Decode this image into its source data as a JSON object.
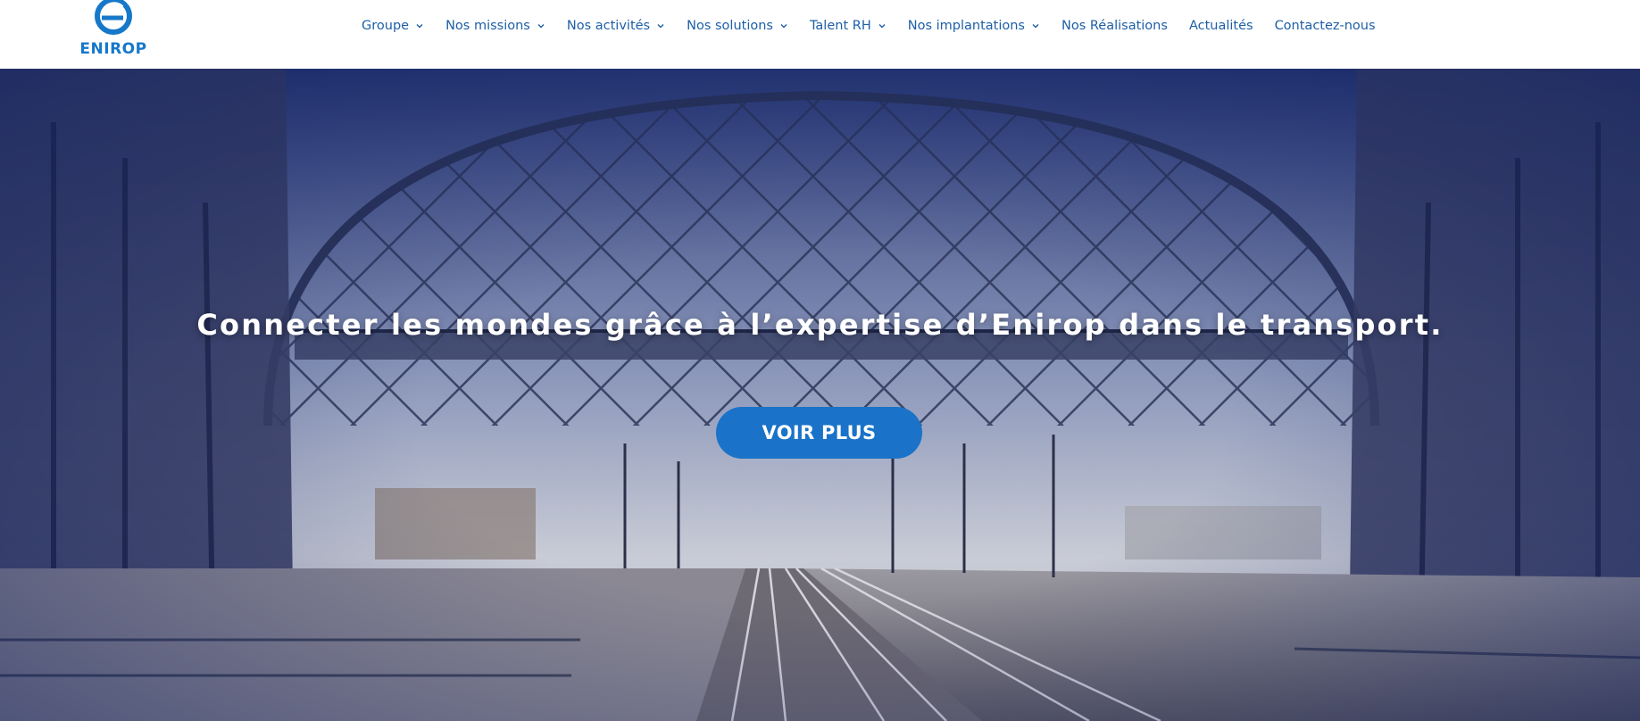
{
  "brand": {
    "name": "ENIROP",
    "color": "#1678c9"
  },
  "nav": {
    "items": [
      {
        "label": "Groupe",
        "dropdown": true
      },
      {
        "label": "Nos missions",
        "dropdown": true
      },
      {
        "label": "Nos activités",
        "dropdown": true
      },
      {
        "label": "Nos solutions",
        "dropdown": true
      },
      {
        "label": "Talent RH",
        "dropdown": true
      },
      {
        "label": "Nos implantations",
        "dropdown": true
      },
      {
        "label": "Nos Réalisations",
        "dropdown": false
      },
      {
        "label": "Actualités",
        "dropdown": false
      },
      {
        "label": "Contactez-nous",
        "dropdown": false
      }
    ],
    "color": "#1e5fa6"
  },
  "hero": {
    "title": "Connecter les mondes grâce à l’expertise d’Enirop dans le transport.",
    "cta_label": "VOIR PLUS",
    "cta_color": "#1a73c8",
    "background": "train-station-photo"
  }
}
